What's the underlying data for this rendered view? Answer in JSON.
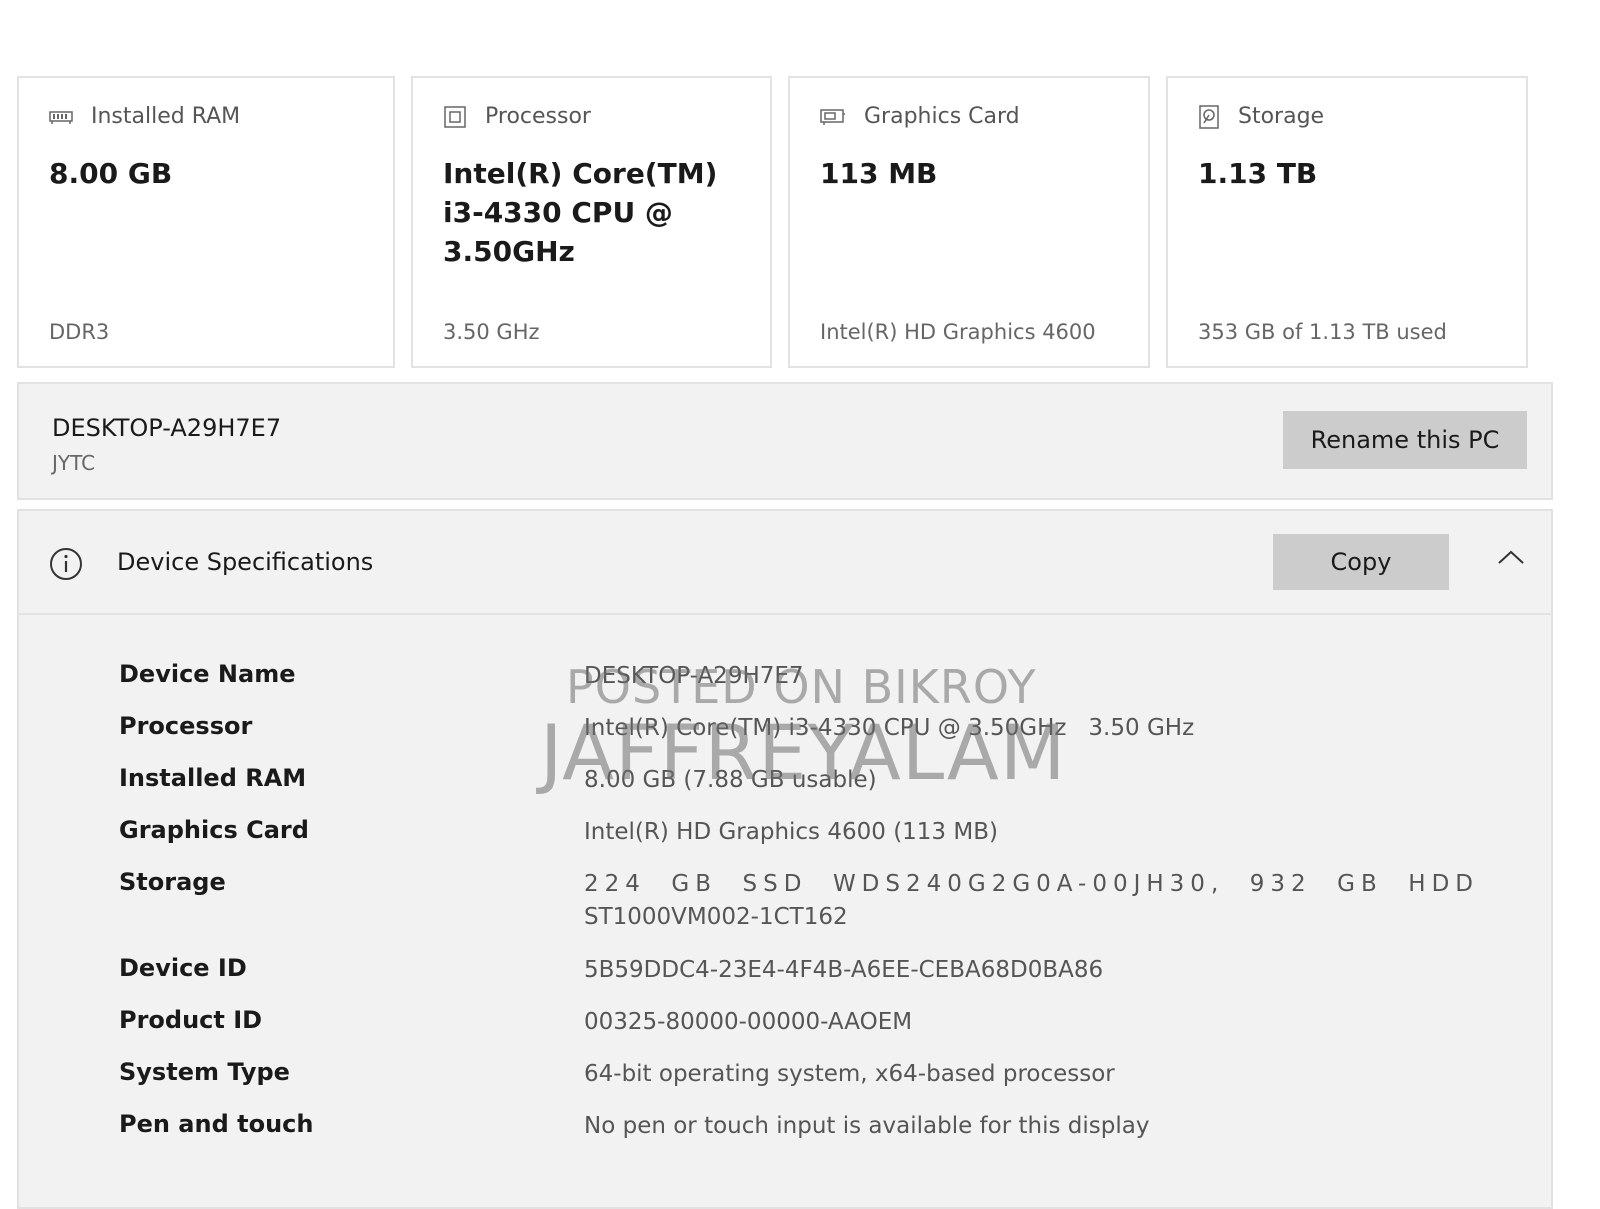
{
  "cards": [
    {
      "icon": "ram-icon",
      "title": "Installed RAM",
      "value": "8.00 GB",
      "sub": "DDR3"
    },
    {
      "icon": "processor-icon",
      "title": "Processor",
      "value": "Intel(R) Core(TM) i3-4330 CPU @ 3.50GHz",
      "sub": "3.50 GHz"
    },
    {
      "icon": "graphics-card-icon",
      "title": "Graphics Card",
      "value": "113 MB",
      "sub": "Intel(R) HD Graphics 4600"
    },
    {
      "icon": "storage-icon",
      "title": "Storage",
      "value": "1.13 TB",
      "sub": "353 GB of 1.13 TB used"
    }
  ],
  "pc": {
    "name": "DESKTOP-A29H7E7",
    "org": "JYTC",
    "rename_label": "Rename this PC"
  },
  "specs": {
    "title": "Device Specifications",
    "copy_label": "Copy",
    "rows": [
      {
        "label": "Device Name",
        "value": "DESKTOP-A29H7E7"
      },
      {
        "label": "Processor",
        "value": "Intel(R) Core(TM) i3-4330 CPU @ 3.50GHz   3.50 GHz"
      },
      {
        "label": "Installed RAM",
        "value": "8.00 GB (7.88 GB usable)"
      },
      {
        "label": "Graphics Card",
        "value": "Intel(R) HD Graphics 4600 (113 MB)"
      },
      {
        "label": "Storage",
        "value_line1": [
          "224",
          "GB",
          "SSD",
          "WDS240G2G0A-00JH30,",
          "932",
          "GB",
          "HDD"
        ],
        "value_line2": "ST1000VM002-1CT162"
      },
      {
        "label": "Device ID",
        "value": "5B59DDC4-23E4-4F4B-A6EE-CEBA68D0BA86"
      },
      {
        "label": "Product ID",
        "value": "00325-80000-00000-AAOEM"
      },
      {
        "label": "System Type",
        "value": "64-bit operating system, x64-based processor"
      },
      {
        "label": "Pen and touch",
        "value": "No pen or touch input is available for this display"
      }
    ]
  },
  "watermark": {
    "line1": "POSTED ON BIKROY",
    "line2": "JAFFREYALAM"
  }
}
